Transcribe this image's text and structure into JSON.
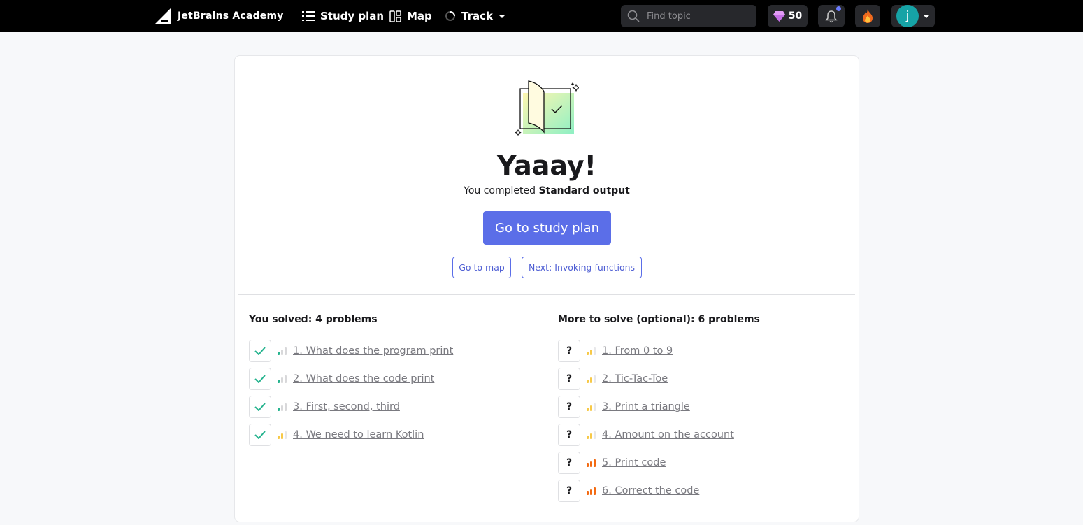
{
  "header": {
    "logo_text": "JetBrains Academy",
    "nav": {
      "study_plan": "Study plan",
      "map": "Map",
      "track": "Track"
    },
    "search_placeholder": "Find topic",
    "gems_count": "50",
    "avatar_letter": "j",
    "colors": {
      "notification_dot": "#6b7cff",
      "avatar_bg": "#16a3a6",
      "gem": "#c56ee6"
    }
  },
  "completion": {
    "title": "Yaaay!",
    "subtitle_prefix": "You completed ",
    "topic_name": "Standard output",
    "primary_button": "Go to study plan",
    "map_button": "Go to map",
    "next_button": "Next: Invoking functions",
    "accent_color": "#5b6ee8"
  },
  "solved": {
    "heading": "You solved: 4 problems",
    "items": [
      {
        "label": "1. What does the program print",
        "difficulty": "easy"
      },
      {
        "label": "2. What does the code print",
        "difficulty": "easy"
      },
      {
        "label": "3. First, second, third",
        "difficulty": "easy"
      },
      {
        "label": "4. We need to learn Kotlin",
        "difficulty": "medium"
      }
    ]
  },
  "more": {
    "heading": "More to solve (optional): 6 problems",
    "items": [
      {
        "label": "1. From 0 to 9",
        "difficulty": "medium"
      },
      {
        "label": "2. Tic-Tac-Toe",
        "difficulty": "medium"
      },
      {
        "label": "3. Print a triangle",
        "difficulty": "medium"
      },
      {
        "label": "4. Amount on the account",
        "difficulty": "medium"
      },
      {
        "label": "5. Print code",
        "difficulty": "hard"
      },
      {
        "label": "6. Correct the code",
        "difficulty": "hard"
      }
    ]
  },
  "difficulty_colors": {
    "easy": [
      "#27b48f",
      "#d8d8da",
      "#d8d8da"
    ],
    "medium": [
      "#f7c948",
      "#f7c948",
      "#e8e8ea"
    ],
    "hard": [
      "#f36a12",
      "#f36a12",
      "#f36a12"
    ]
  }
}
